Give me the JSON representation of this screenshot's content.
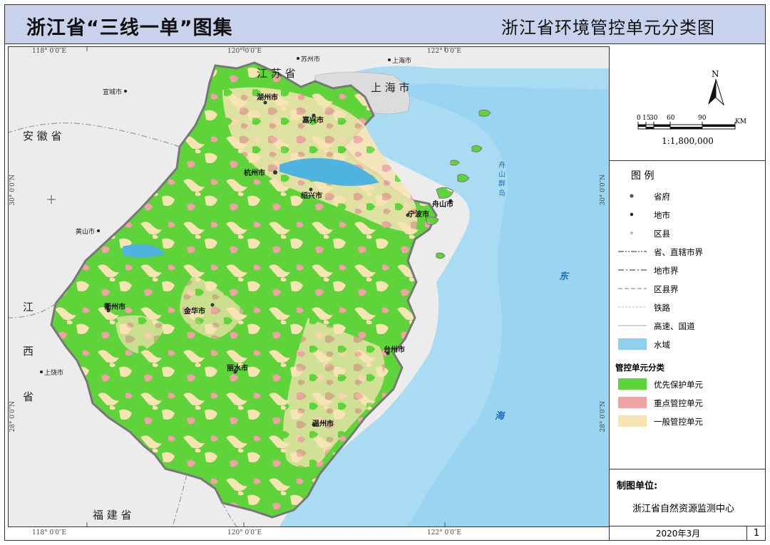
{
  "header": {
    "atlas_title": "浙江省“三线一单”图集",
    "map_title": "浙江省环境管控单元分类图"
  },
  "coords": {
    "top": [
      "118° 0′0″E",
      "120° 0′0″E",
      "122° 0′0″E"
    ],
    "bottom": [
      "118° 0′0″E",
      "120° 0′0″E",
      "122° 0′0″E"
    ],
    "left": [
      "30° 0′0″N",
      "28° 0′0″N"
    ],
    "right": [
      "30° 0′0″N",
      "28° 0′0″N"
    ]
  },
  "map": {
    "provinces": [
      "安 徽 省",
      "江 苏 省",
      "江 西 省",
      "福 建 省",
      "上 海 市"
    ],
    "sea": [
      "东",
      "海"
    ],
    "islands": [
      "舟 山 群 岛"
    ],
    "outside_cities": [
      "苏州市",
      "上海市",
      "宣城市",
      "黄山市",
      "上饶市"
    ],
    "cities": [
      "杭州市",
      "湖州市",
      "嘉兴市",
      "绍兴市",
      "宁波市",
      "舟山市",
      "金华市",
      "衢州市",
      "台州市",
      "丽水市",
      "温州市"
    ]
  },
  "panel": {
    "north": "N",
    "scale_ticks": [
      "0",
      "15",
      "30",
      "60",
      "90"
    ],
    "scale_unit": "KM",
    "scale_ratio": "1:1,800,000"
  },
  "legend": {
    "title": "图 例",
    "items": [
      {
        "label": "省府"
      },
      {
        "label": "地市"
      },
      {
        "label": "区县"
      },
      {
        "label": "省、直辖市界"
      },
      {
        "label": "地市界"
      },
      {
        "label": "区县界"
      },
      {
        "label": "铁路"
      },
      {
        "label": "高速、国道"
      },
      {
        "label": "水域"
      }
    ],
    "category_title": "管控单元分类",
    "categories": [
      {
        "label": "优先保护单元",
        "color": "#5fd33a"
      },
      {
        "label": "重点管控单元",
        "color": "#f0a3a3"
      },
      {
        "label": "一般管控单元",
        "color": "#f6e4b2"
      }
    ],
    "water_color": "#8fd0ef"
  },
  "footer": {
    "org_label": "制图单位:",
    "org_name": "浙江省自然资源监测中心",
    "date": "2020年3月",
    "page": "1"
  }
}
